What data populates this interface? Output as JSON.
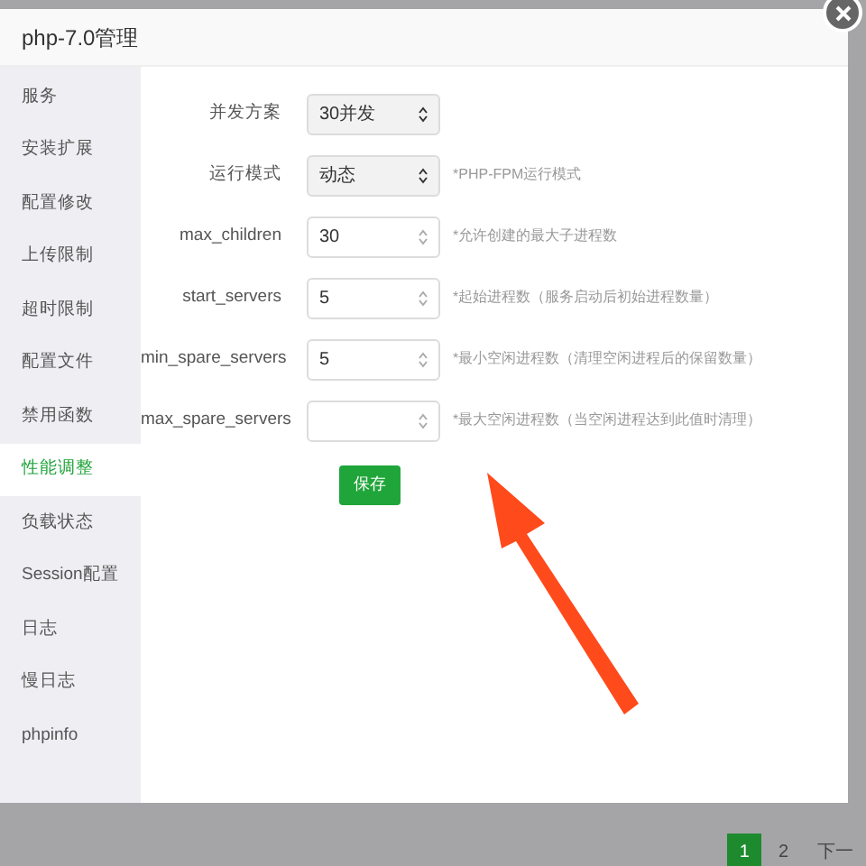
{
  "dialog": {
    "title": "php-7.0管理"
  },
  "sidebar": {
    "items": [
      {
        "label": "服务",
        "selected": false
      },
      {
        "label": "安装扩展",
        "selected": false
      },
      {
        "label": "配置修改",
        "selected": false
      },
      {
        "label": "上传限制",
        "selected": false
      },
      {
        "label": "超时限制",
        "selected": false
      },
      {
        "label": "配置文件",
        "selected": false
      },
      {
        "label": "禁用函数",
        "selected": false
      },
      {
        "label": "性能调整",
        "selected": true
      },
      {
        "label": "负载状态",
        "selected": false
      },
      {
        "label": "Session配置",
        "selected": false
      },
      {
        "label": "日志",
        "selected": false
      },
      {
        "label": "慢日志",
        "selected": false
      },
      {
        "label": "phpinfo",
        "selected": false
      }
    ]
  },
  "form": {
    "rows": [
      {
        "kind": "select",
        "label": "并发方案",
        "value": "30并发"
      },
      {
        "kind": "select",
        "label": "运行模式",
        "value": "动态",
        "hint": "*PHP-FPM运行模式"
      },
      {
        "kind": "number",
        "label": "max_children",
        "value": "30",
        "hint": "*允许创建的最大子进程数"
      },
      {
        "kind": "number",
        "label": "start_servers",
        "value": "5",
        "hint": "*起始进程数（服务启动后初始进程数量）"
      },
      {
        "kind": "number",
        "label": "min_spare_servers",
        "value": "5",
        "hint": "*最小空闲进程数（清理空闲进程后的保留数量）"
      },
      {
        "kind": "number",
        "label": "max_spare_servers",
        "hint": "*最大空闲进程数（当空闲进程达到此值时清理）"
      }
    ],
    "save_button": "保存"
  },
  "pagination": [
    {
      "label": "1",
      "selected": true
    },
    {
      "label": "2",
      "selected": false
    },
    {
      "label": "下一",
      "selected": false
    }
  ]
}
